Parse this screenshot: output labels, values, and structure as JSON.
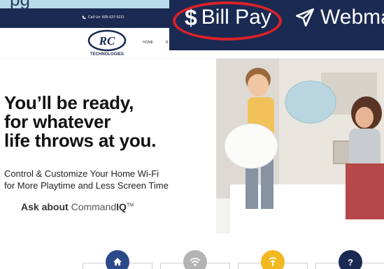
{
  "topbar": {
    "call_text": "Call Us: 605-637-5211"
  },
  "nav": {
    "home": "HOME",
    "next_partial": "R"
  },
  "logo": {
    "mark": "RC",
    "name": "TECHNOLOGIES"
  },
  "zoom": {
    "bill_pay_icon": "$",
    "bill_pay": "Bill Pay",
    "webmail": "Webma"
  },
  "hero": {
    "headline": [
      "You’ll be ready,",
      "for whatever",
      "life throws at you."
    ],
    "subline": [
      "Control & Customize Your Home Wi-Fi",
      "for More Playtime and Less Screen Time"
    ],
    "ask_prefix": "Ask about",
    "ask_product_a": "Command",
    "ask_product_b": "IQ",
    "ask_tm": "TM"
  },
  "cards": [
    {
      "icon": "home-icon",
      "color": "#2c4a8a"
    },
    {
      "icon": "wifi-icon",
      "color": "#b3b3b3"
    },
    {
      "icon": "signal-icon",
      "color": "#f2b820"
    },
    {
      "icon": "question-icon",
      "glyph": "?",
      "color": "#1b2a52"
    }
  ],
  "colors": {
    "navy": "#1b2a52",
    "highlight_red": "#d9222a"
  }
}
